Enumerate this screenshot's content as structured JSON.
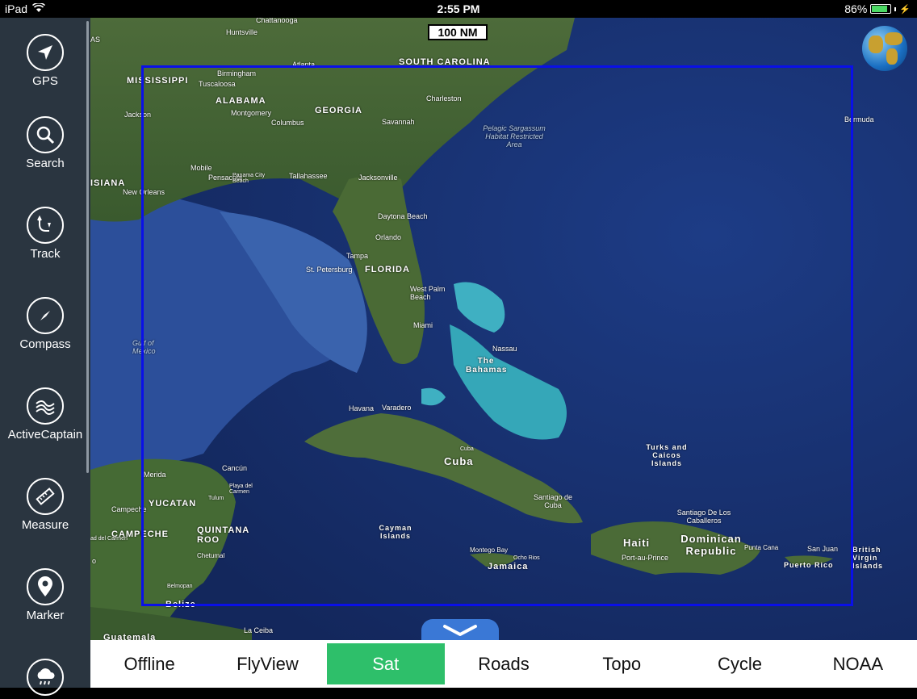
{
  "status": {
    "device": "iPad",
    "time": "2:55 PM",
    "battery": "86%",
    "battery_level": 0.86
  },
  "sidebar": {
    "items": [
      {
        "label": "GPS",
        "icon": "navigation-arrow-icon"
      },
      {
        "label": "Search",
        "icon": "magnifier-icon"
      },
      {
        "label": "Track",
        "icon": "track-icon"
      },
      {
        "label": "Compass",
        "icon": "compass-icon"
      },
      {
        "label": "ActiveCaptain",
        "icon": "activecaptain-icon"
      },
      {
        "label": "Measure",
        "icon": "ruler-icon"
      },
      {
        "label": "Marker",
        "icon": "location-pin-icon"
      },
      {
        "label": "",
        "icon": "weather-cloud-icon"
      }
    ]
  },
  "map": {
    "scale_label": "100 NM",
    "selection_color": "#0a10e8",
    "labels": {
      "chattanooga": "Chattanooga",
      "huntsville": "Huntsville",
      "atlanta": "Atlanta",
      "south_carolina": "SOUTH CAROLINA",
      "mississippi": "MISSISSIPPI",
      "birmingham": "Birmingham",
      "tuscaloosa": "Tuscaloosa",
      "alabama": "ALABAMA",
      "georgia": "GEORGIA",
      "montgomery": "Montgomery",
      "columbus": "Columbus",
      "charleston": "Charleston",
      "savannah": "Savannah",
      "jackson": "Jackson",
      "pelagic": "Pelagic Sargassum Habitat Restricted Area",
      "bermuda": "Bermuda",
      "mobile": "Mobile",
      "pensacola": "Pensacola",
      "panama_city": "Panama City Beach",
      "tallahassee": "Tallahassee",
      "jacksonville": "Jacksonville",
      "louisiana": "ISIANA",
      "new_orleans": "New Orleans",
      "daytona": "Daytona Beach",
      "orlando": "Orlando",
      "tampa": "Tampa",
      "st_pete": "St. Petersburg",
      "florida": "FLORIDA",
      "west_palm": "West Palm Beach",
      "miami": "Miami",
      "gulf": "Gulf of Mexico",
      "nassau": "Nassau",
      "bahamas": "The Bahamas",
      "havana": "Havana",
      "varadero": "Varadero",
      "cuba": "Cuba",
      "cuba_city": "Cuba",
      "turks": "Turks and Caicos Islands",
      "merida": "Merida",
      "cancun": "Cancún",
      "yucatan": "YUCATAN",
      "playa": "Playa del Carmen",
      "campeche_city": "Campeche",
      "tulum": "Tulum",
      "campeche": "CAMPECHE",
      "quintana": "QUINTANA ROO",
      "cayman": "Cayman Islands",
      "santiago_cuba": "Santiago de Cuba",
      "santiago_dr": "Santiago De Los Caballeros",
      "haiti": "Haiti",
      "dominican": "Dominican Republic",
      "port_au_prince": "Port-au-Prince",
      "punta_cana": "Punta Cana",
      "montego": "Montego Bay",
      "ocho_rios": "Ocho Rios",
      "jamaica": "Jamaica",
      "chetumal": "Chetumal",
      "belmopan": "Belmopan",
      "belize": "Belize",
      "san_juan": "San Juan",
      "puerto_rico": "Puerto Rico",
      "bvi": "British Virgin Islands",
      "la_ceiba": "La Ceiba",
      "guatemala": "Guatemala",
      "mississippi_abbr": "AS",
      "left_edge_o": "o",
      "left_edge_ad": "ad del Carmen"
    }
  },
  "layers": [
    {
      "label": "Offline",
      "active": false
    },
    {
      "label": "FlyView",
      "active": false
    },
    {
      "label": "Sat",
      "active": true
    },
    {
      "label": "Roads",
      "active": false
    },
    {
      "label": "Topo",
      "active": false
    },
    {
      "label": "Cycle",
      "active": false
    },
    {
      "label": "NOAA",
      "active": false
    }
  ]
}
